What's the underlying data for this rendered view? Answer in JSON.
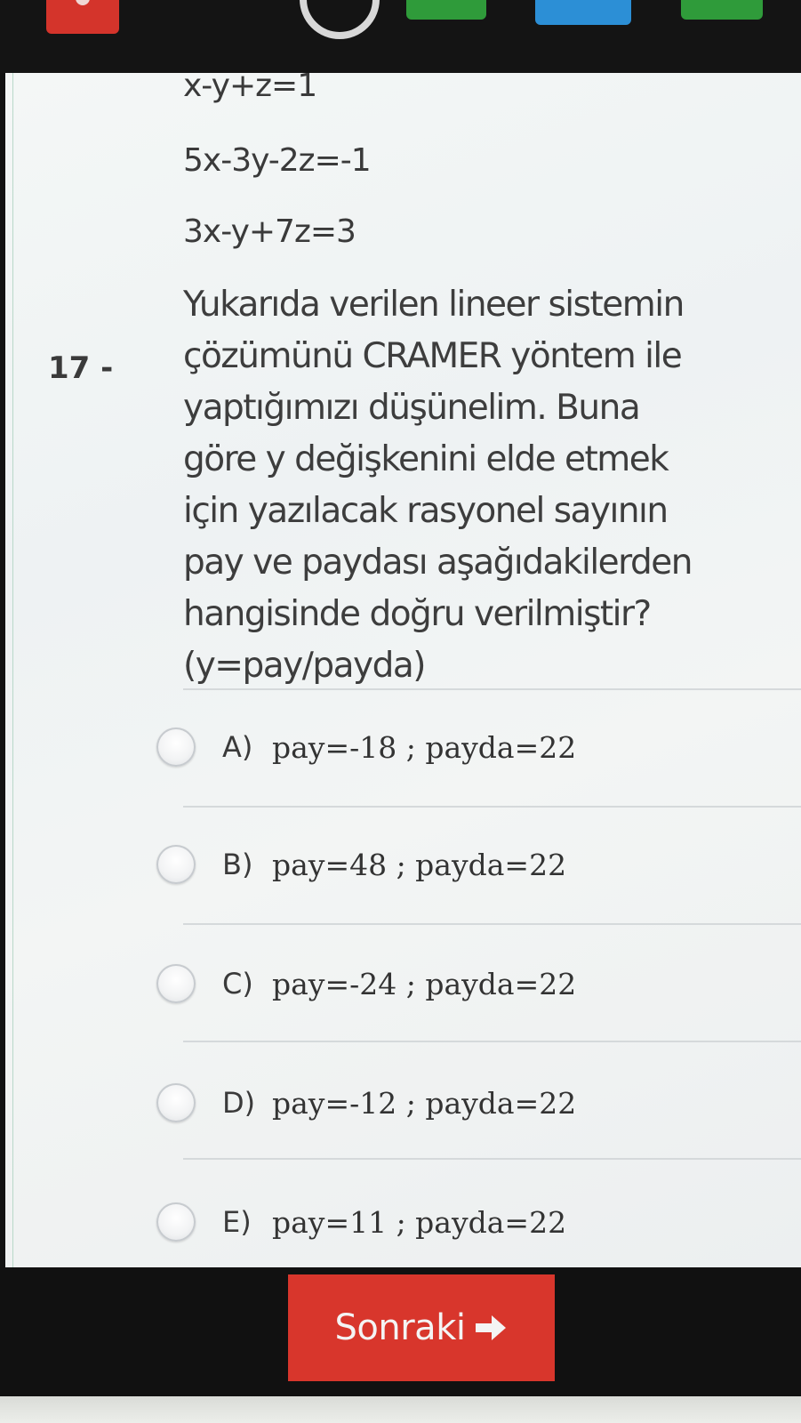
{
  "question": {
    "number": "17 -",
    "equations": [
      "x-y+z=1",
      "5x-3y-2z=-1",
      "3x-y+7z=3"
    ],
    "text_lines": [
      "Yukarıda verilen lineer sistemin",
      "çözümünü CRAMER yöntem ile",
      "yaptığımızı düşünelim. Buna",
      "göre y değişkenini elde etmek",
      "için yazılacak rasyonel sayının",
      "pay ve paydası aşağıdakilerden",
      "hangisinde doğru verilmiştir?",
      "(y=pay/payda)"
    ]
  },
  "options": [
    {
      "letter": "A)",
      "text": "pay=-18 ; payda=22"
    },
    {
      "letter": "B)",
      "text": "pay=48 ; payda=22"
    },
    {
      "letter": "C)",
      "text": "pay=-24 ; payda=22"
    },
    {
      "letter": "D)",
      "text": "pay=-12 ; payda=22"
    },
    {
      "letter": "E)",
      "text": "pay=11 ; payda=22"
    }
  ],
  "footer": {
    "next_label": "Sonraki",
    "next_icon": "arrow-right-icon"
  },
  "toolbar_icons": [
    "help-icon",
    "timer-icon"
  ],
  "colors": {
    "accent_red": "#d8362c",
    "green": "#2f9b3a",
    "blue": "#2c8fd6",
    "text": "#3d3d3d"
  }
}
